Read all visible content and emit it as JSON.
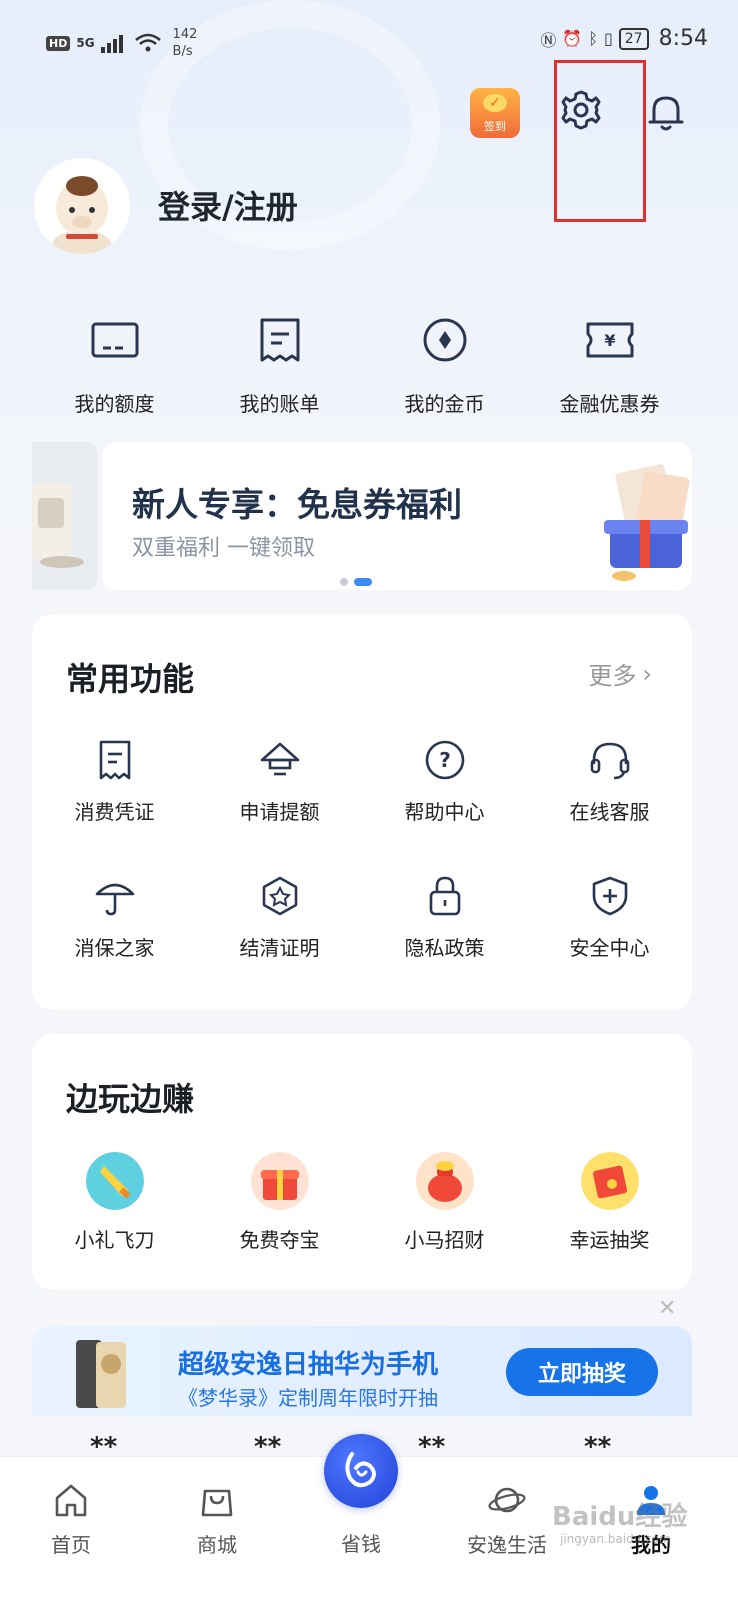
{
  "status_bar": {
    "hd": "HD",
    "network": "5G",
    "speed_value": "142",
    "speed_unit": "B/s",
    "battery": "27",
    "time": "8:54"
  },
  "header": {
    "sign_in_label": "签到",
    "login_text": "登录/注册"
  },
  "quick_items": [
    {
      "label": "我的额度",
      "icon": "card-icon"
    },
    {
      "label": "我的账单",
      "icon": "bill-icon"
    },
    {
      "label": "我的金币",
      "icon": "coin-icon"
    },
    {
      "label": "金融优惠券",
      "icon": "coupon-icon"
    }
  ],
  "banner": {
    "title": "新人专享：免息券福利",
    "subtitle": "双重福利 一键领取"
  },
  "common_functions": {
    "title": "常用功能",
    "more": "更多",
    "items": [
      {
        "label": "消费凭证",
        "icon": "receipt-icon"
      },
      {
        "label": "申请提额",
        "icon": "raise-limit-icon"
      },
      {
        "label": "帮助中心",
        "icon": "help-icon"
      },
      {
        "label": "在线客服",
        "icon": "headset-icon"
      },
      {
        "label": "消保之家",
        "icon": "umbrella-icon"
      },
      {
        "label": "结清证明",
        "icon": "certificate-icon"
      },
      {
        "label": "隐私政策",
        "icon": "lock-icon"
      },
      {
        "label": "安全中心",
        "icon": "shield-icon"
      }
    ]
  },
  "play_earn": {
    "title": "边玩边赚",
    "items": [
      {
        "label": "小礼飞刀",
        "icon": "flying-knife-icon"
      },
      {
        "label": "免费夺宝",
        "icon": "gift-box-icon"
      },
      {
        "label": "小马招财",
        "icon": "money-bag-icon"
      },
      {
        "label": "幸运抽奖",
        "icon": "red-envelope-icon"
      }
    ]
  },
  "promo": {
    "title": "超级安逸日抽华为手机",
    "subtitle": "《梦华录》定制周年限时开抽",
    "button": "立即抽奖",
    "masked": [
      "**",
      "**",
      "**",
      "**"
    ]
  },
  "tabs": [
    {
      "label": "首页",
      "icon": "home-icon"
    },
    {
      "label": "商城",
      "icon": "shopping-bag-icon"
    },
    {
      "label": "省钱",
      "icon": "save-money-icon"
    },
    {
      "label": "安逸生活",
      "icon": "planet-icon"
    },
    {
      "label": "我的",
      "icon": "user-icon"
    }
  ],
  "watermark": {
    "main": "Baidu经验",
    "sub": "jingyan.baidu.com"
  },
  "colors": {
    "accent_blue": "#1673e8",
    "highlight_red": "#e0302e",
    "icon_navy": "#2a3550"
  }
}
